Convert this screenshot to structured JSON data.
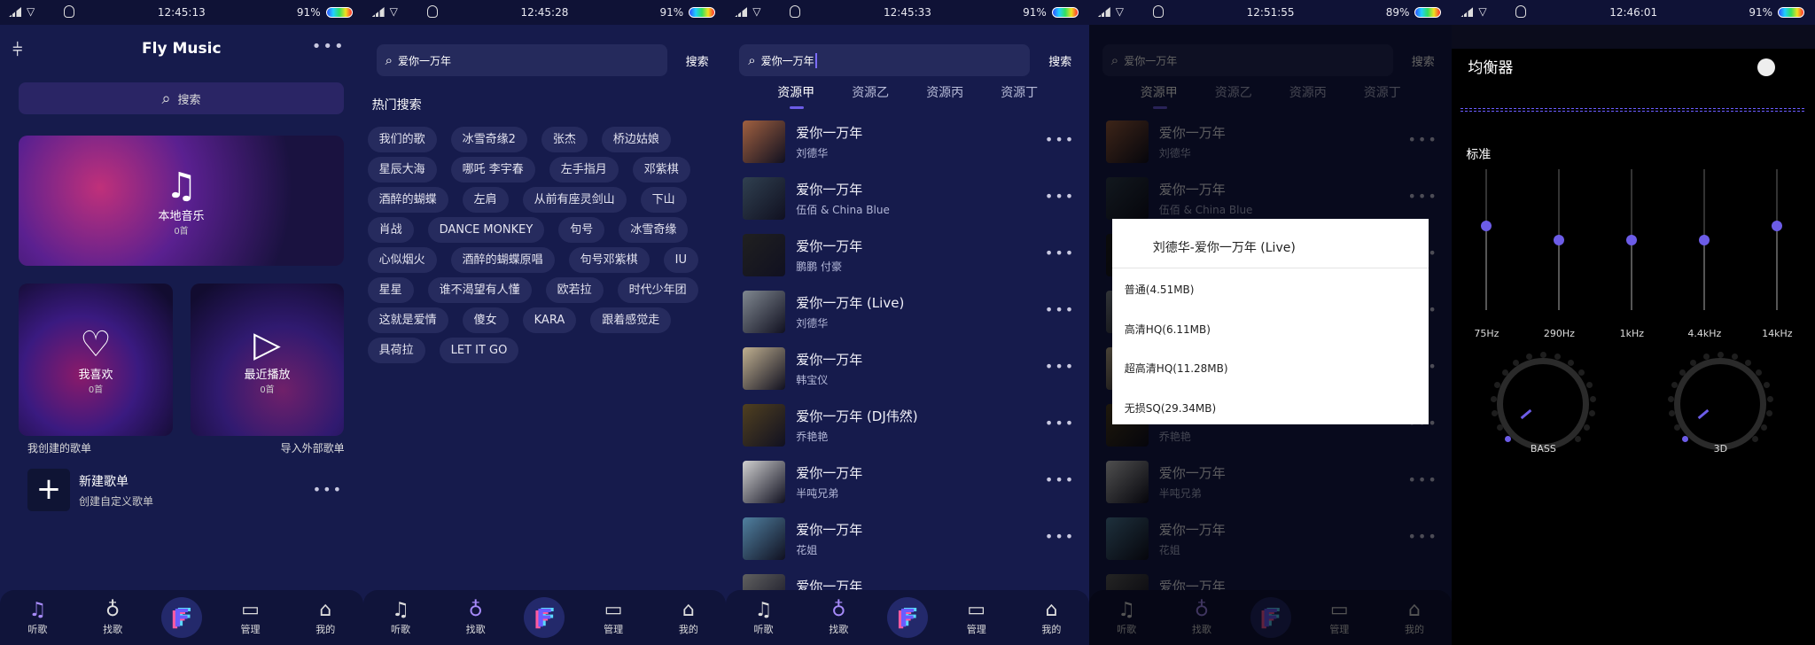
{
  "colors": {
    "accent": "#6c5ce7",
    "background": "#161b4c",
    "eq_background": "#000000"
  },
  "screens": [
    {
      "time": "12:45:13",
      "battery": "91%"
    },
    {
      "time": "12:45:28",
      "battery": "91%"
    },
    {
      "time": "12:45:33",
      "battery": "91%"
    },
    {
      "time": "12:51:55",
      "battery": "89%"
    },
    {
      "time": "12:46:01",
      "battery": "91%"
    }
  ],
  "home": {
    "title": "Fly Music",
    "search_placeholder": "搜索",
    "local": {
      "label": "本地音乐",
      "count": "0首"
    },
    "fav": {
      "label": "我喜欢",
      "count": "0首"
    },
    "recent": {
      "label": "最近播放",
      "count": "0首"
    },
    "my_playlists": "我创建的歌单",
    "import": "导入外部歌单",
    "new_playlist": {
      "title": "新建歌单",
      "subtitle": "创建自定义歌单"
    }
  },
  "nav": {
    "items": [
      {
        "label": "听歌",
        "icon": "music-note-icon"
      },
      {
        "label": "找歌",
        "icon": "planet-icon"
      },
      {
        "label": "",
        "icon": "app-logo-icon"
      },
      {
        "label": "管理",
        "icon": "folder-icon"
      },
      {
        "label": "我的",
        "icon": "shirt-icon"
      }
    ]
  },
  "search": {
    "query": "爱你一万年",
    "button": "搜索",
    "hot_title": "热门搜索",
    "tags": [
      "我们的歌",
      "冰雪奇缘2",
      "张杰",
      "桥边姑娘",
      "星辰大海",
      "哪吒 李宇春",
      "左手指月",
      "邓紫棋",
      "酒醉的蝴蝶",
      "左肩",
      "从前有座灵剑山",
      "下山",
      "肖战",
      "DANCE MONKEY",
      "句号",
      "冰雪奇缘",
      "心似烟火",
      "酒醉的蝴蝶原唱",
      "句号邓紫棋",
      "IU",
      "星星",
      "谁不渴望有人懂",
      "欧若拉",
      "时代少年团",
      "这就是爱情",
      "傻女",
      "KARA",
      "跟着感觉走",
      "具荷拉",
      "LET IT GO"
    ]
  },
  "results": {
    "tabs": [
      "资源甲",
      "资源乙",
      "资源丙",
      "资源丁"
    ],
    "active_tab": 0,
    "items": [
      {
        "title": "爱你一万年",
        "artist": "刘德华"
      },
      {
        "title": "爱你一万年",
        "artist": "伍佰 & China Blue"
      },
      {
        "title": "爱你一万年",
        "artist": "鹏鹏  付豪"
      },
      {
        "title": "爱你一万年 (Live)",
        "artist": "刘德华"
      },
      {
        "title": "爱你一万年",
        "artist": "韩宝仪"
      },
      {
        "title": "爱你一万年 (DJ伟然)",
        "artist": "乔艳艳"
      },
      {
        "title": "爱你一万年",
        "artist": "半吨兄弟"
      },
      {
        "title": "爱你一万年",
        "artist": "花姐"
      },
      {
        "title": "爱你一万年",
        "artist": ""
      }
    ]
  },
  "dialog": {
    "title": "刘德华-爱你一万年 (Live)",
    "options": [
      "普通(4.51MB)",
      "高清HQ(6.11MB)",
      "超高清HQ(11.28MB)",
      "无损SQ(29.34MB)"
    ]
  },
  "eq": {
    "title": "均衡器",
    "enabled": false,
    "preset": "标准",
    "bands": [
      {
        "label": "75Hz",
        "level": 0.6
      },
      {
        "label": "290Hz",
        "level": 0.5
      },
      {
        "label": "1kHz",
        "level": 0.5
      },
      {
        "label": "4.4kHz",
        "level": 0.5
      },
      {
        "label": "14kHz",
        "level": 0.6
      }
    ],
    "knobs": [
      {
        "label": "BASS",
        "value": 0
      },
      {
        "label": "3D",
        "value": 0
      }
    ]
  }
}
